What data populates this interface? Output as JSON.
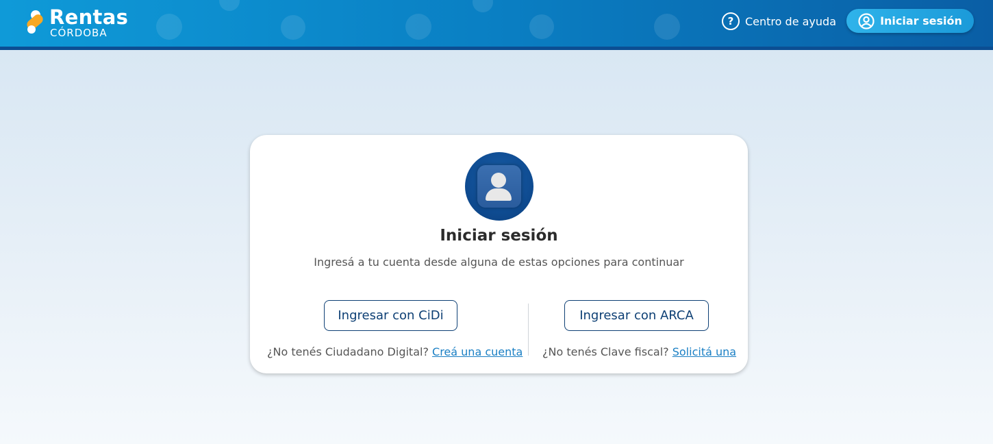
{
  "header": {
    "logo_title": "Rentas",
    "logo_subtitle": "CÓRDOBA",
    "help_icon_glyph": "?",
    "help_label": "Centro de ayuda",
    "login_label": "Iniciar sesión"
  },
  "card": {
    "title": "Iniciar sesión",
    "subtitle": "Ingresá a tu cuenta desde alguna de estas opciones para continuar",
    "cidi": {
      "button_label": "Ingresar con CiDi",
      "note_text": "¿No tenés Ciudadano Digital?",
      "link_label": "Creá una cuenta"
    },
    "arca": {
      "button_label": "Ingresar con ARCA",
      "note_text": "¿No tenés Clave fiscal?",
      "link_label": "Solicitá una"
    }
  },
  "icons": {
    "help": "question-circle-icon",
    "login": "user-circle-icon",
    "avatar": "user-silhouette-icon"
  },
  "colors": {
    "header_start": "#0f9ad8",
    "header_end": "#0a5ea5",
    "accent_orange": "#f7a823",
    "button_border": "#0d3f74",
    "link": "#1a7fc4",
    "login_button": "#1b9ad9"
  }
}
